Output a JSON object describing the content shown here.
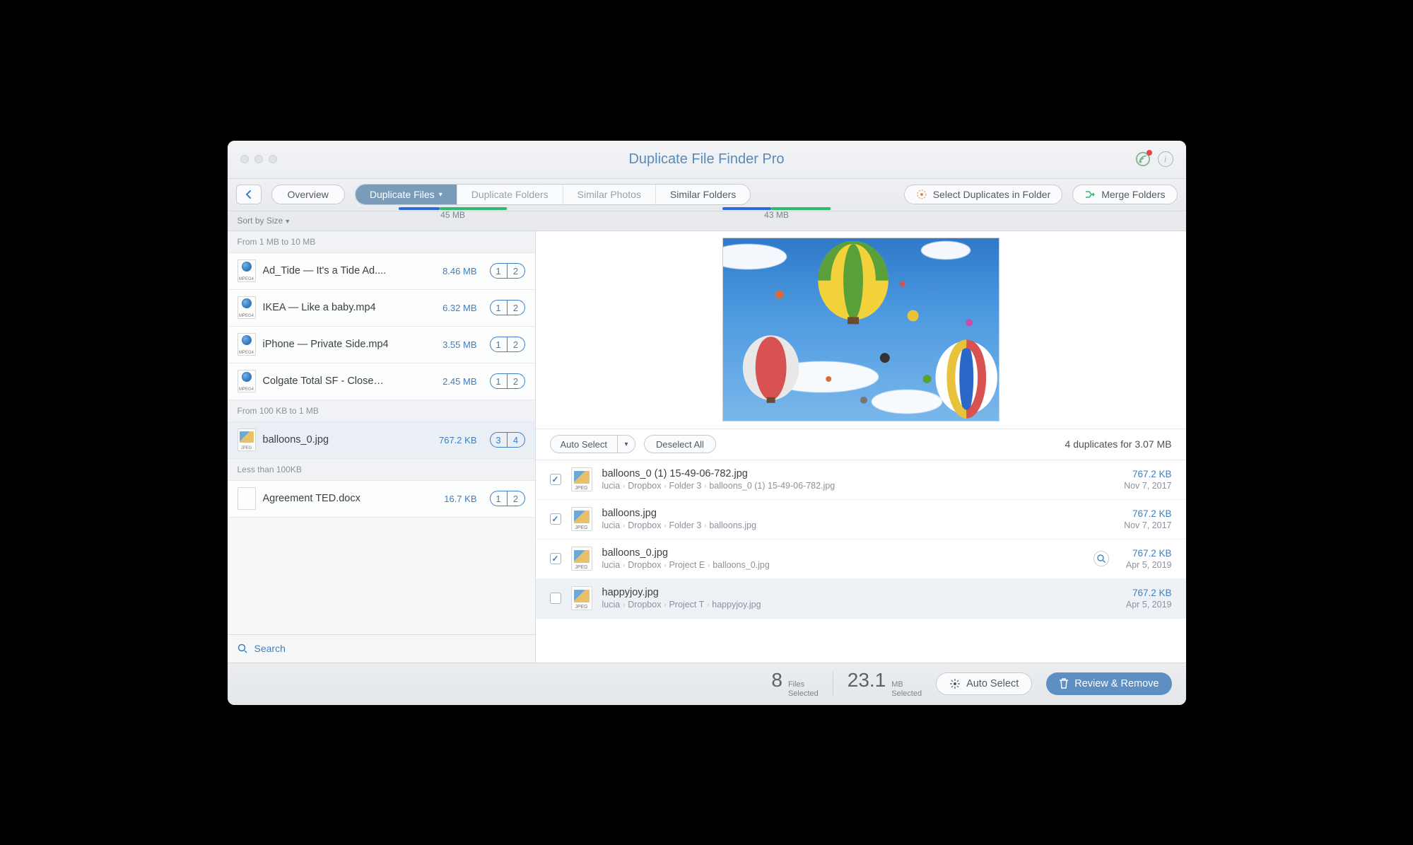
{
  "title": "Duplicate File Finder Pro",
  "toolbar": {
    "overview": "Overview",
    "tabs": [
      "Duplicate Files",
      "Duplicate Folders",
      "Similar Photos",
      "Similar Folders"
    ],
    "active_tab_size": "45 MB",
    "similar_folders_size": "43 MB",
    "select_in_folder": "Select Duplicates in Folder",
    "merge_folders": "Merge Folders"
  },
  "sort_label": "Sort by Size",
  "groups": [
    {
      "header": "From 1 MB to 10 MB",
      "items": [
        {
          "name": "Ad_Tide — It's a Tide Ad....",
          "size": "8.46 MB",
          "c1": "1",
          "c2": "2",
          "type": "mpeg4"
        },
        {
          "name": "IKEA — Like a baby.mp4",
          "size": "6.32 MB",
          "c1": "1",
          "c2": "2",
          "type": "mpeg4"
        },
        {
          "name": "iPhone — Private Side.mp4",
          "size": "3.55 MB",
          "c1": "1",
          "c2": "2",
          "type": "mpeg4"
        },
        {
          "name": "Colgate Total SF - Close…",
          "size": "2.45 MB",
          "c1": "1",
          "c2": "2",
          "type": "mpeg4"
        }
      ]
    },
    {
      "header": "From 100 KB to 1 MB",
      "items": [
        {
          "name": "balloons_0.jpg",
          "size": "767.2 KB",
          "c1": "3",
          "c2": "4",
          "type": "jpeg",
          "selected": true
        }
      ]
    },
    {
      "header": "Less than 100KB",
      "items": [
        {
          "name": "Agreement TED.docx",
          "size": "16.7 KB",
          "c1": "1",
          "c2": "2",
          "type": "doc"
        }
      ]
    }
  ],
  "search_label": "Search",
  "dup_bar": {
    "auto_select": "Auto Select",
    "deselect_all": "Deselect All",
    "summary": "4 duplicates for 3.07 MB"
  },
  "duplicates": [
    {
      "checked": true,
      "name": "balloons_0 (1) 15-49-06-782.jpg",
      "path": [
        "lucia",
        "Dropbox",
        "Folder 3",
        "balloons_0 (1) 15-49-06-782.jpg"
      ],
      "size": "767.2 KB",
      "date": "Nov 7, 2017"
    },
    {
      "checked": true,
      "name": "balloons.jpg",
      "path": [
        "lucia",
        "Dropbox",
        "Folder 3",
        "balloons.jpg"
      ],
      "size": "767.2 KB",
      "date": "Nov 7, 2017"
    },
    {
      "checked": true,
      "name": "balloons_0.jpg",
      "path": [
        "lucia",
        "Dropbox",
        "Project E",
        "balloons_0.jpg"
      ],
      "size": "767.2 KB",
      "date": "Apr 5, 2019",
      "eye": true
    },
    {
      "checked": false,
      "name": "happyjoy.jpg",
      "path": [
        "lucia",
        "Dropbox",
        "Project T",
        "happyjoy.jpg"
      ],
      "size": "767.2 KB",
      "date": "Apr 5, 2019",
      "hover": true
    }
  ],
  "footer": {
    "files_count": "8",
    "files_label_1": "Files",
    "files_label_2": "Selected",
    "mb_count": "23.1",
    "mb_label_1": "MB",
    "mb_label_2": "Selected",
    "auto_select": "Auto Select",
    "review": "Review & Remove"
  }
}
